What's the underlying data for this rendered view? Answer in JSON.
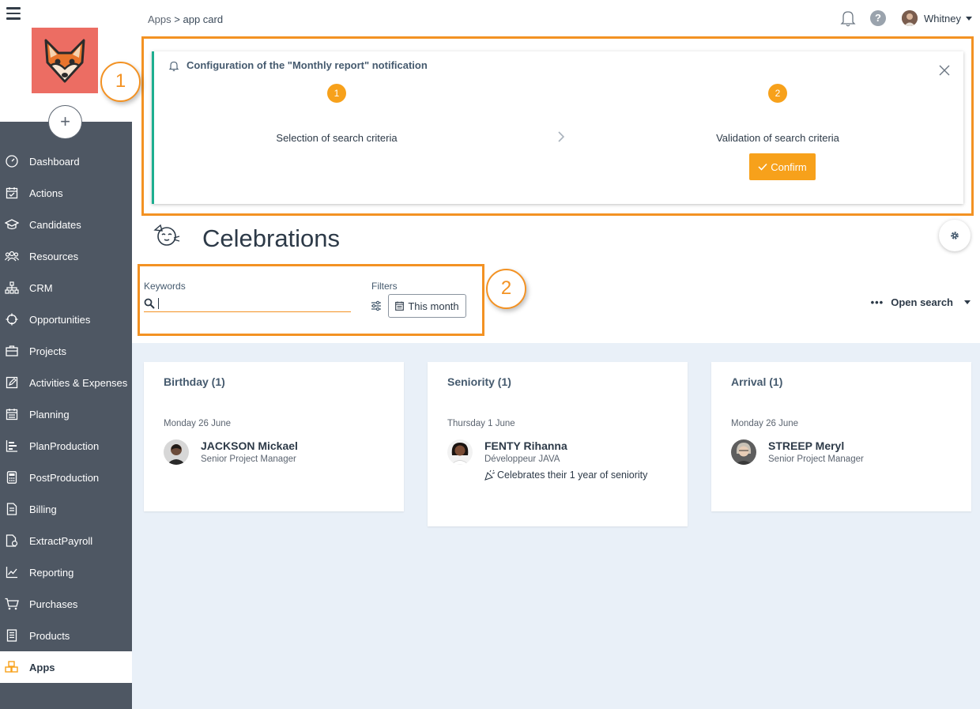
{
  "sidebar": {
    "items": [
      {
        "label": "Dashboard",
        "icon": "dashboard-gauge-icon"
      },
      {
        "label": "Actions",
        "icon": "calendar-check-icon"
      },
      {
        "label": "Candidates",
        "icon": "graduation-cap-icon"
      },
      {
        "label": "Resources",
        "icon": "users-icon"
      },
      {
        "label": "CRM",
        "icon": "org-chart-icon"
      },
      {
        "label": "Opportunities",
        "icon": "target-icon"
      },
      {
        "label": "Projects",
        "icon": "briefcase-icon"
      },
      {
        "label": "Activities & Expenses",
        "icon": "edit-icon"
      },
      {
        "label": "Planning",
        "icon": "calendar-icon"
      },
      {
        "label": "PlanProduction",
        "icon": "bars-icon"
      },
      {
        "label": "PostProduction",
        "icon": "calculator-icon"
      },
      {
        "label": "Billing",
        "icon": "invoice-icon"
      },
      {
        "label": "ExtractPayroll",
        "icon": "payroll-doc-icon"
      },
      {
        "label": "Reporting",
        "icon": "line-chart-icon"
      },
      {
        "label": "Purchases",
        "icon": "cart-icon"
      },
      {
        "label": "Products",
        "icon": "catalog-icon"
      },
      {
        "label": "Apps",
        "icon": "cubes-icon",
        "active": true
      }
    ]
  },
  "breadcrumb": {
    "parent": "Apps",
    "separator": ">",
    "current": "app card"
  },
  "header": {
    "user_name": "Whitney"
  },
  "callouts": {
    "one": "1",
    "two": "2"
  },
  "notification": {
    "title": "Configuration of the \"Monthly report\" notification",
    "step1_num": "1",
    "step1_label": "Selection of search criteria",
    "step2_num": "2",
    "step2_label": "Validation of search criteria",
    "confirm_label": "Confirm"
  },
  "page": {
    "title": "Celebrations"
  },
  "search": {
    "keywords_label": "Keywords",
    "keywords_value": "",
    "filters_label": "Filters",
    "period_label": "This month",
    "open_search_label": "Open search"
  },
  "cards": [
    {
      "title": "Birthday (1)",
      "date": "Monday 26 June",
      "name": "JACKSON Mickael",
      "role": "Senior Project Manager",
      "note": ""
    },
    {
      "title": "Seniority (1)",
      "date": "Thursday 1 June",
      "name": "FENTY Rihanna",
      "role": "Développeur JAVA",
      "note": "Celebrates their 1 year of seniority"
    },
    {
      "title": "Arrival (1)",
      "date": "Monday 26 June",
      "name": "STREEP Meryl",
      "role": "Senior Project Manager",
      "note": ""
    }
  ],
  "colors": {
    "accent": "#f7a11b",
    "highlight": "#f39223",
    "sidebar": "#4e5763",
    "content_bg": "#e9f0f8",
    "step_border": "#1eae90"
  }
}
